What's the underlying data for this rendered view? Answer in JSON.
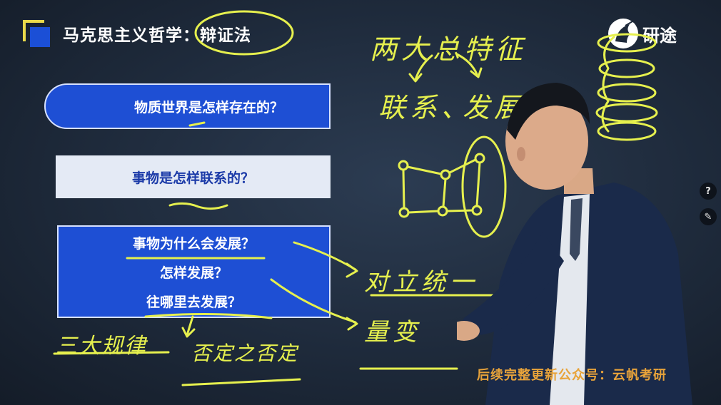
{
  "header": {
    "title": "马克思主义哲学：辩证法",
    "brand": "研途"
  },
  "questions": [
    {
      "lines": [
        "物质世界是怎样存在的？"
      ]
    },
    {
      "lines": [
        "事物是怎样联系的？"
      ]
    },
    {
      "lines": [
        "事物为什么会发展？",
        "怎样发展？",
        "往哪里去发展？"
      ]
    }
  ],
  "handwriting": {
    "two_features": "两大总特征",
    "link": "联系、",
    "develop": "发展",
    "unity": "对立统一",
    "quantity": "量变",
    "three_laws": "三大规律",
    "negation": "否定之否定"
  },
  "controls": {
    "help": "?",
    "note": "✎"
  },
  "watermark": "后续完整更新公众号：云帆考研",
  "colors": {
    "background": "#1e2a3b",
    "box_blue": "#1e4fd4",
    "box_light": "#e4eaf5",
    "chalk": "#e6f04e",
    "watermark": "#e8a33a",
    "logo_yellow": "#e9d94a"
  }
}
